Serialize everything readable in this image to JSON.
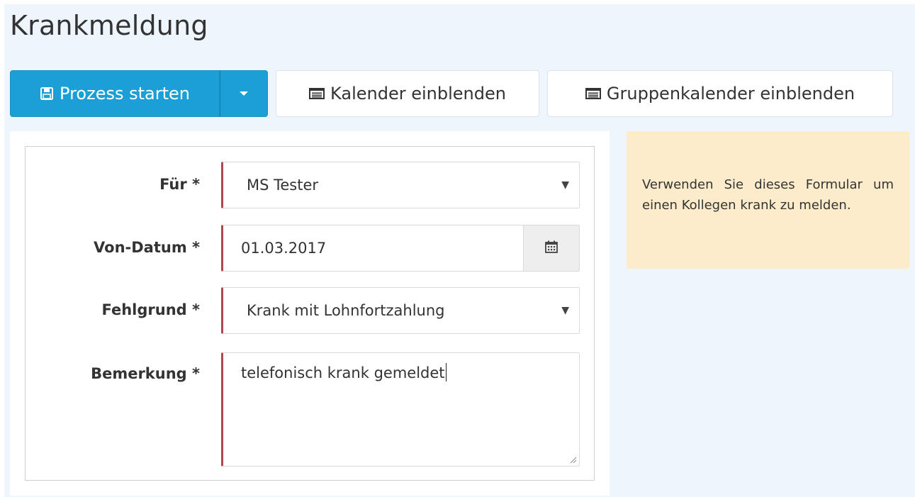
{
  "page": {
    "title": "Krankmeldung"
  },
  "toolbar": {
    "start_label": "Prozess starten",
    "start_icon": "save-icon",
    "dropdown_icon": "caret-down-icon",
    "calendar_label": "Kalender einblenden",
    "calendar_icon": "list-icon",
    "group_calendar_label": "Gruppenkalender einblenden",
    "group_calendar_icon": "list-icon"
  },
  "form": {
    "fields": {
      "fuer": {
        "label": "Für *",
        "value": "MS Tester"
      },
      "von_datum": {
        "label": "Von-Datum *",
        "value": "01.03.2017",
        "icon": "calendar-icon"
      },
      "fehlgrund": {
        "label": "Fehlgrund *",
        "value": "Krank mit Lohnfortzahlung"
      },
      "bemerkung": {
        "label": "Bemerkung *",
        "value": "telefonisch krank gemeldet"
      }
    }
  },
  "info": {
    "text": "Verwenden Sie dieses Formular um einen Kollegen krank zu melden."
  },
  "colors": {
    "primary": "#1c9fd6",
    "required_border": "#b4474a",
    "info_background": "#fdeccb",
    "page_background": "#eef5fd"
  }
}
